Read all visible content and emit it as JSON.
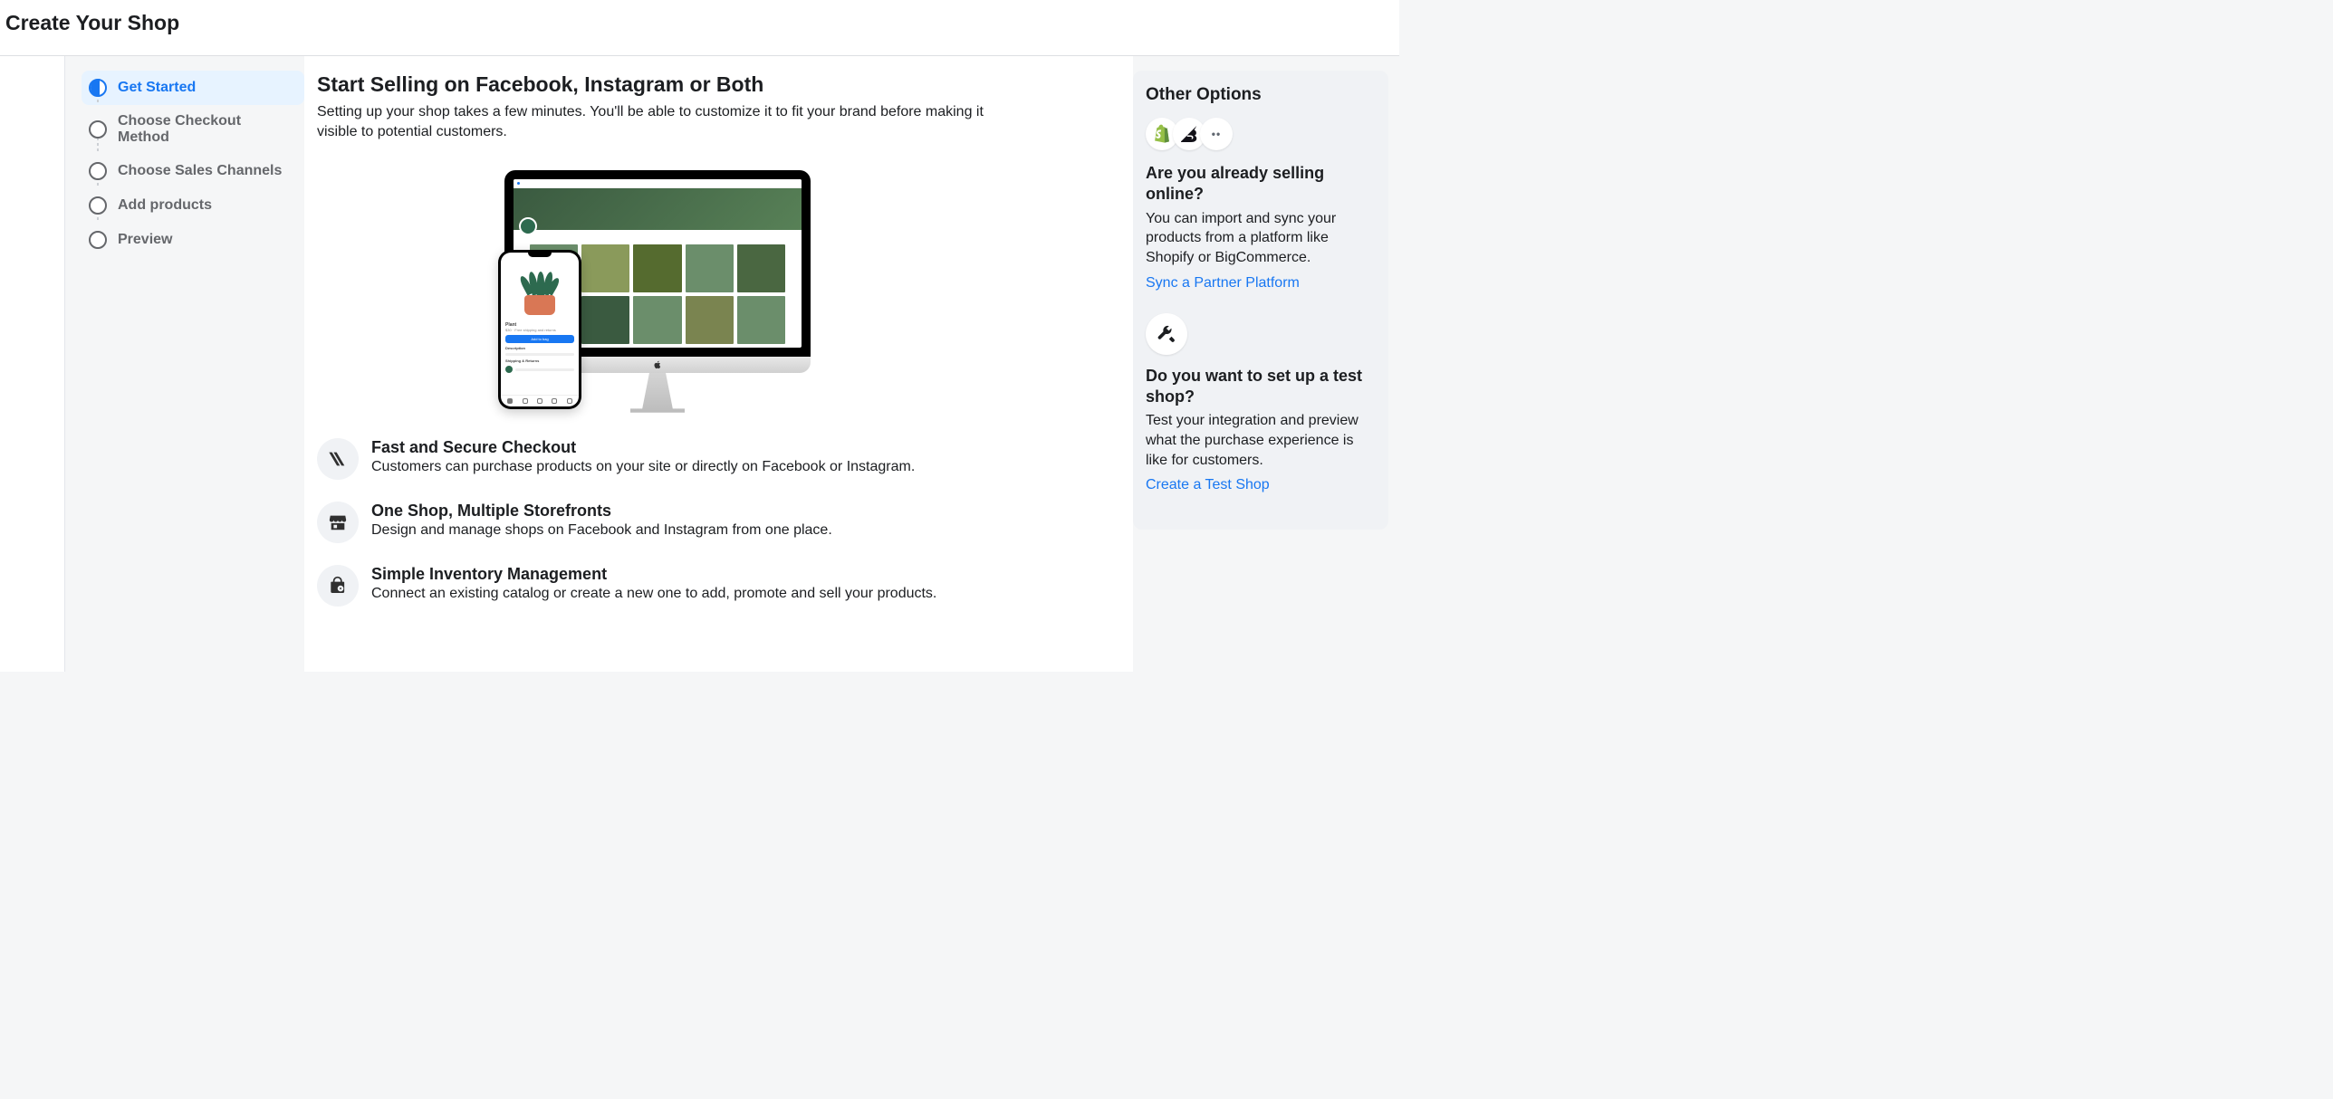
{
  "header": {
    "title": "Create Your Shop"
  },
  "steps": [
    {
      "label": "Get Started",
      "active": true
    },
    {
      "label": "Choose Checkout Method",
      "active": false
    },
    {
      "label": "Choose Sales Channels",
      "active": false
    },
    {
      "label": "Add products",
      "active": false
    },
    {
      "label": "Preview",
      "active": false
    }
  ],
  "main": {
    "heading": "Start Selling on Facebook, Instagram or Both",
    "subheading": "Setting up your shop takes a few minutes. You'll be able to customize it to fit your brand before making it visible to potential customers."
  },
  "features": [
    {
      "title": "Fast and Secure Checkout",
      "desc": "Customers can purchase products on your site or directly on Facebook or Instagram."
    },
    {
      "title": "One Shop, Multiple Storefronts",
      "desc": "Design and manage shops on Facebook and Instagram from one place."
    },
    {
      "title": "Simple Inventory Management",
      "desc": "Connect an existing catalog or create a new one to add, promote and sell your products."
    }
  ],
  "right": {
    "heading": "Other Options",
    "partner": {
      "title": "Are you already selling online?",
      "desc": "You can import and sync your products from a platform like Shopify or BigCommerce.",
      "link": "Sync a Partner Platform"
    },
    "test": {
      "title": "Do you want to set up a test shop?",
      "desc": "Test your integration and preview what the purchase experience is like for customers.",
      "link": "Create a Test Shop"
    }
  }
}
